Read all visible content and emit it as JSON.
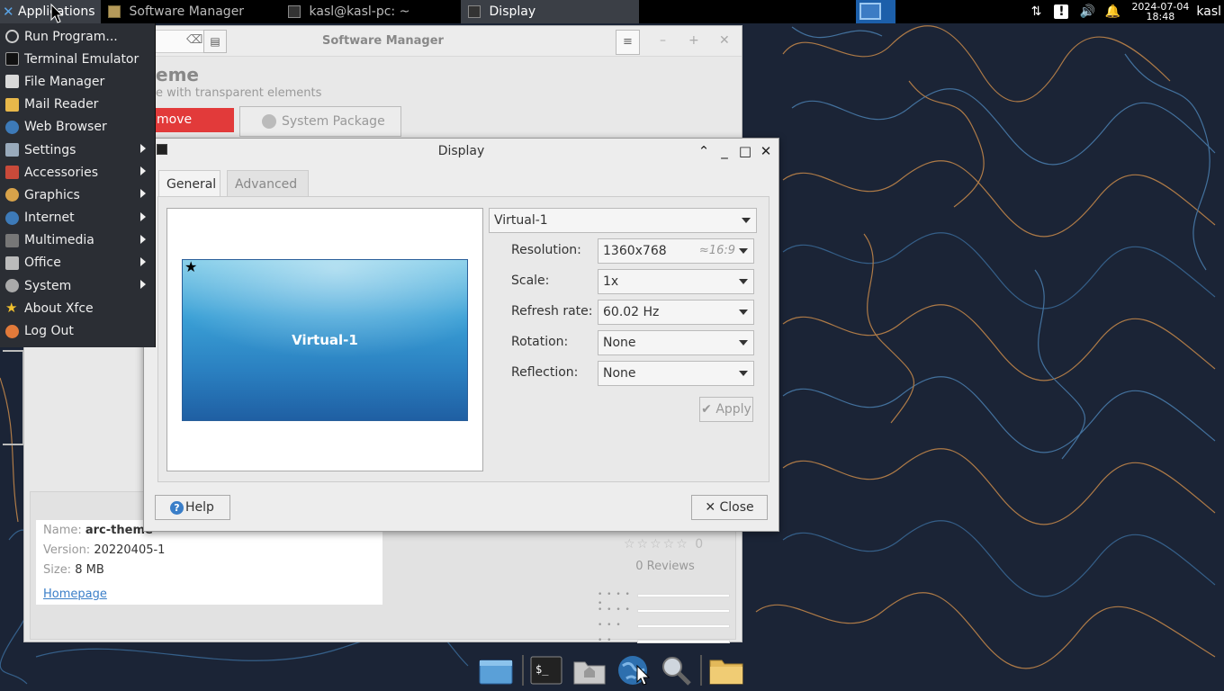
{
  "top_panel": {
    "apps_label": "Applications",
    "tasks": [
      {
        "label": "Software Manager"
      },
      {
        "label": "kasl@kasl-pc: ~"
      },
      {
        "label": "Display"
      }
    ],
    "clock_date": "2024-07-04",
    "clock_time": "18:48",
    "user": "kasl"
  },
  "app_menu": {
    "items": [
      {
        "label": "Run Program...",
        "icon": "run-icon",
        "submenu": false
      },
      {
        "label": "Terminal Emulator",
        "icon": "terminal-icon",
        "submenu": false
      },
      {
        "label": "File Manager",
        "icon": "folder-icon",
        "submenu": false
      },
      {
        "label": "Mail Reader",
        "icon": "mail-icon",
        "submenu": false
      },
      {
        "label": "Web Browser",
        "icon": "globe-icon",
        "submenu": false
      },
      {
        "label": "Settings",
        "icon": "settings-icon",
        "submenu": true
      },
      {
        "label": "Accessories",
        "icon": "accessories-icon",
        "submenu": true
      },
      {
        "label": "Graphics",
        "icon": "graphics-icon",
        "submenu": true
      },
      {
        "label": "Internet",
        "icon": "internet-icon",
        "submenu": true
      },
      {
        "label": "Multimedia",
        "icon": "multimedia-icon",
        "submenu": true
      },
      {
        "label": "Office",
        "icon": "office-icon",
        "submenu": true
      },
      {
        "label": "System",
        "icon": "system-icon",
        "submenu": true
      },
      {
        "label": "About Xfce",
        "icon": "star-icon",
        "submenu": false
      },
      {
        "label": "Log Out",
        "icon": "logout-icon",
        "submenu": false
      }
    ]
  },
  "software_manager": {
    "title": "Software Manager",
    "heading": "eme",
    "subtitle": "e with transparent elements",
    "remove_label": "move",
    "system_package_label": "System Package",
    "info": {
      "name_label": "Name:",
      "name_value": "arc-theme",
      "version_label": "Version:",
      "version_value": "20220405-1",
      "size_label": "Size:",
      "size_value": "8 MB",
      "homepage_label": "Homepage"
    },
    "rating": {
      "stars": "☆☆☆☆☆ 0",
      "reviews": "0 Reviews",
      "rows": [
        "• • • • •",
        "• • • •",
        "• • •",
        "• •",
        "•"
      ]
    }
  },
  "display_dialog": {
    "title": "Display",
    "tabs": {
      "general": "General",
      "advanced": "Advanced"
    },
    "monitor_label": "Virtual-1",
    "output_select": "Virtual-1",
    "fields": {
      "resolution_label": "Resolution:",
      "resolution_value": "1360x768",
      "resolution_ratio": "≈16:9",
      "scale_label": "Scale:",
      "scale_value": "1x",
      "refresh_label": "Refresh rate:",
      "refresh_value": "60.02 Hz",
      "rotation_label": "Rotation:",
      "rotation_value": "None",
      "reflection_label": "Reflection:",
      "reflection_value": "None"
    },
    "apply_label": "✔ Apply",
    "help_label": "Help",
    "close_label": "✕ Close"
  },
  "colors": {
    "desktop_bg": "#1b2436",
    "panel_bg": "#000000",
    "menu_bg": "#2b2e34",
    "remove_red": "#e23a3a",
    "accent_blue": "#3a7ec8"
  }
}
